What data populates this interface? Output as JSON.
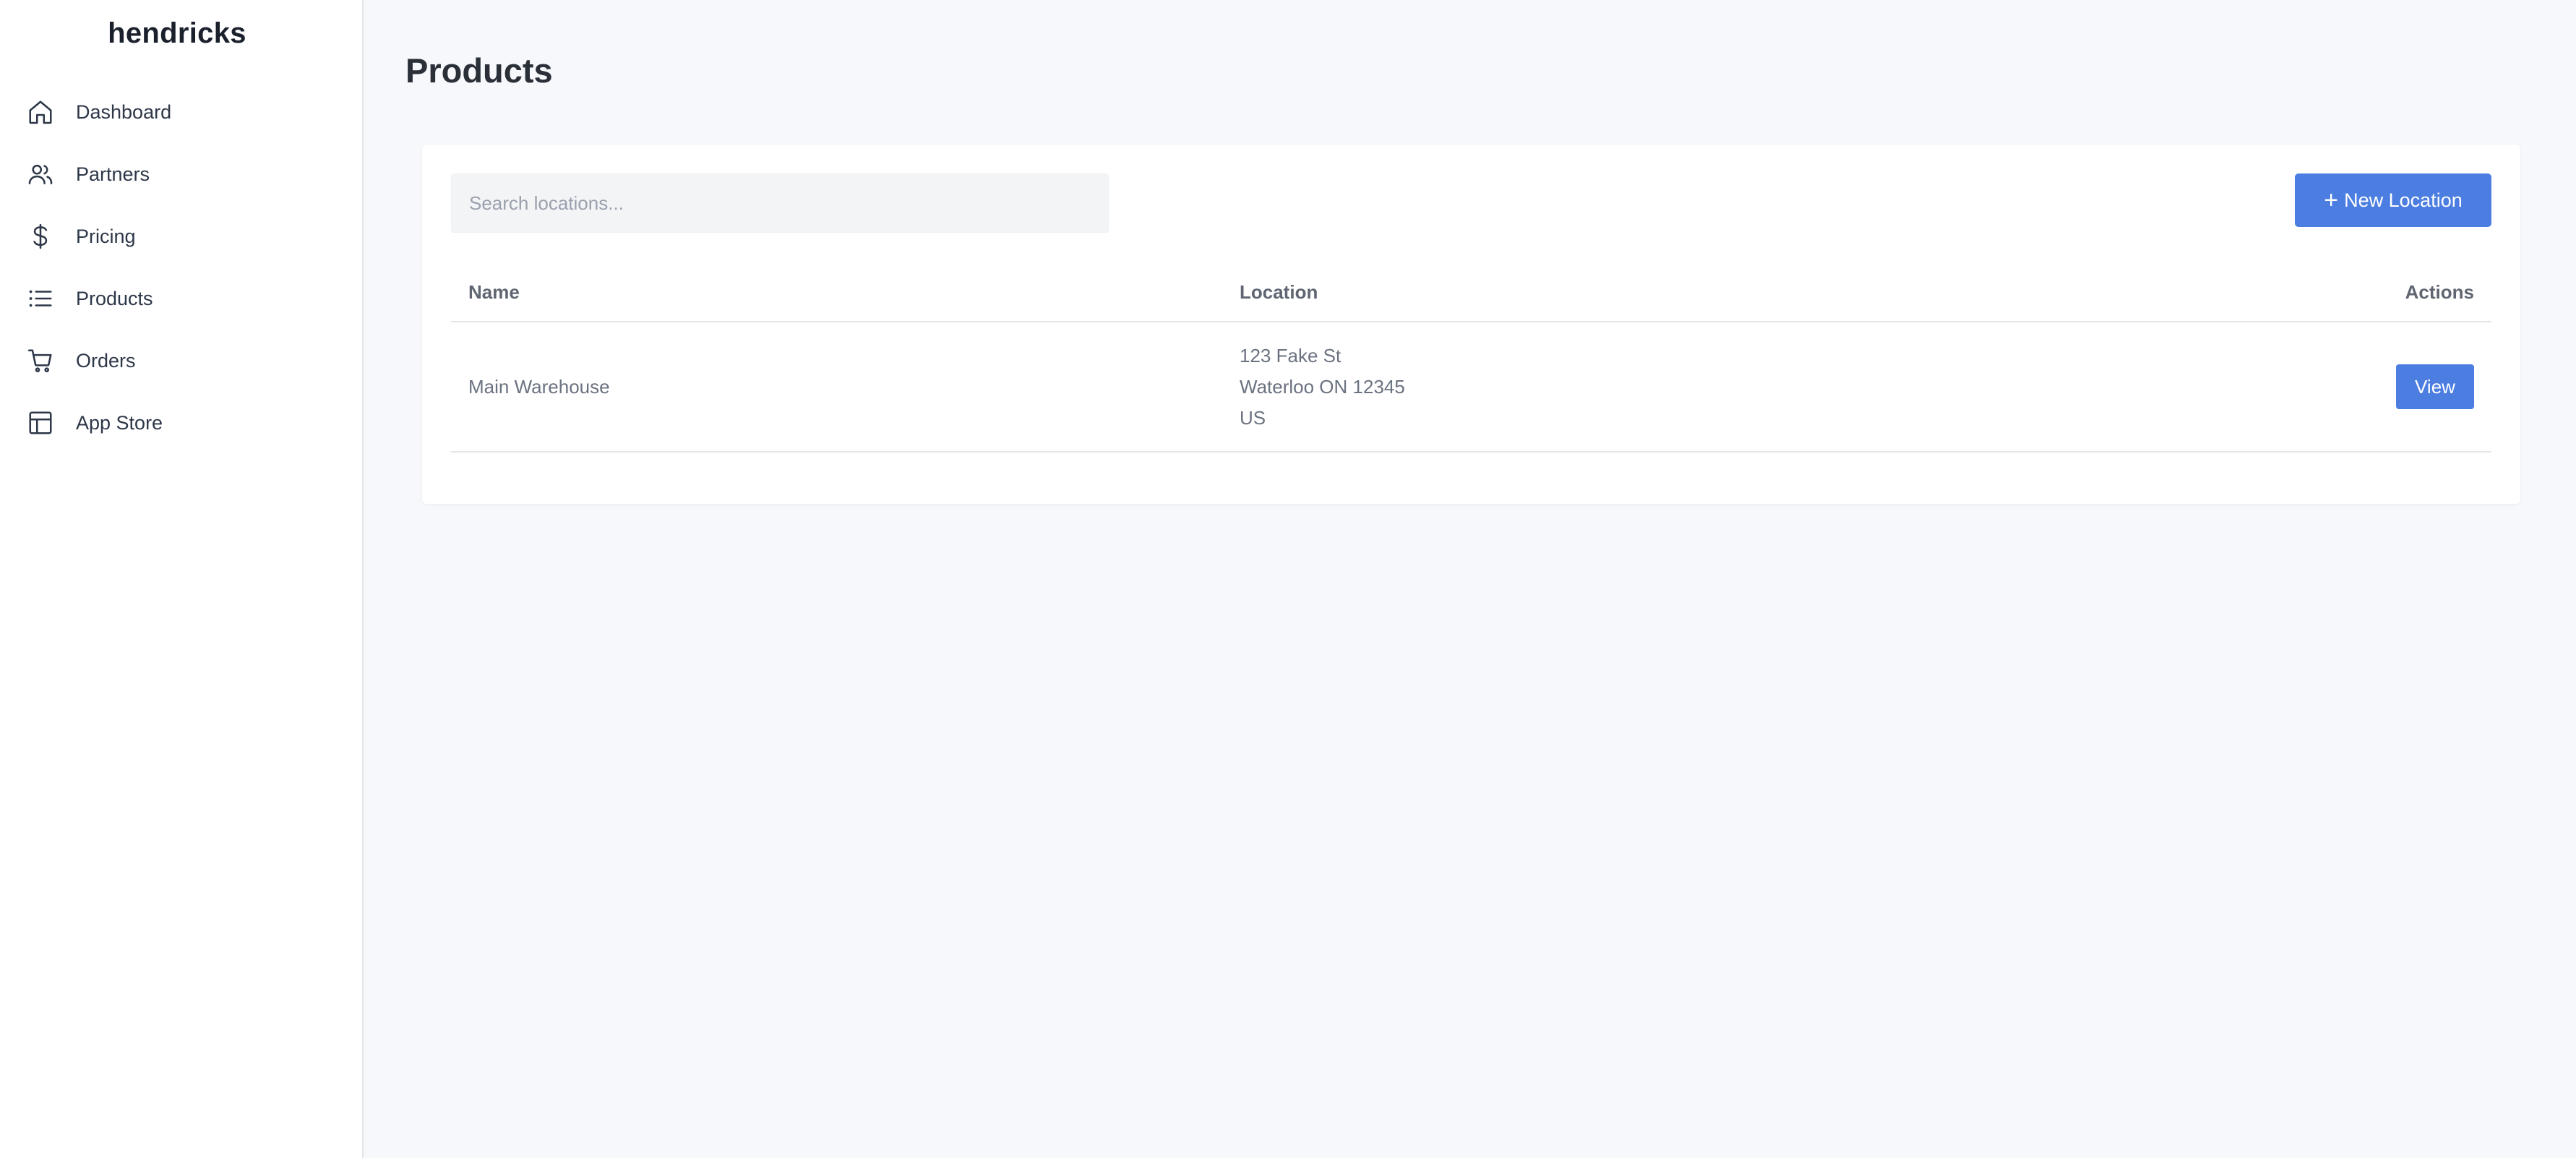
{
  "brand": "hendricks",
  "sidebar": {
    "items": [
      {
        "label": "Dashboard",
        "icon": "home-icon"
      },
      {
        "label": "Partners",
        "icon": "users-icon"
      },
      {
        "label": "Pricing",
        "icon": "dollar-icon"
      },
      {
        "label": "Products",
        "icon": "list-icon"
      },
      {
        "label": "Orders",
        "icon": "cart-icon"
      },
      {
        "label": "App Store",
        "icon": "layout-icon"
      }
    ]
  },
  "page": {
    "title": "Products"
  },
  "search": {
    "placeholder": "Search locations...",
    "value": ""
  },
  "toolbar": {
    "new_location_label": "New Location",
    "new_location_icon": "+"
  },
  "table": {
    "columns": [
      "Name",
      "Location",
      "Actions"
    ],
    "rows": [
      {
        "name": "Main Warehouse",
        "location": [
          "123 Fake St",
          "Waterloo ON 12345",
          "US"
        ],
        "action_label": "View"
      }
    ]
  },
  "colors": {
    "accent": "#4c7ee2",
    "sidebar_bg": "#ffffff",
    "page_bg": "#f7f8fb"
  }
}
